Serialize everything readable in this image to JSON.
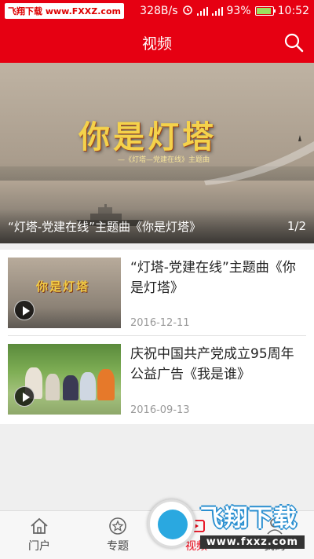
{
  "status_bar": {
    "watermark": "飞翔下载 www.FXXZ.com",
    "speed": "328B/s",
    "net1": "2G",
    "net2": "4G",
    "battery": "93%",
    "battery_level": 0.93,
    "time": "10:52"
  },
  "header": {
    "title": "视频",
    "search_icon": "search-icon"
  },
  "banner": {
    "headline": "你是灯塔",
    "subline": "—《灯塔—党建在线》主题曲",
    "caption": "“灯塔-党建在线”主题曲《你是灯塔》",
    "page": "1/2"
  },
  "videos": [
    {
      "thumb_text": "你是灯塔",
      "title": "“灯塔-党建在线”主题曲《你是灯塔》",
      "date": "2016-12-11"
    },
    {
      "title": "庆祝中国共产党成立95周年公益广告《我是谁》",
      "date": "2016-09-13"
    }
  ],
  "nav": {
    "items": [
      {
        "label": "门户",
        "icon": "home-icon"
      },
      {
        "label": "专题",
        "icon": "star-icon"
      },
      {
        "label": "视频",
        "icon": "video-icon"
      },
      {
        "label": "我的",
        "icon": "user-icon"
      }
    ],
    "active_color": "#e60012"
  },
  "watermark": {
    "brand": "飞翔下载",
    "url": "www.fxxz.com"
  },
  "colors": {
    "primary": "#e60012"
  }
}
